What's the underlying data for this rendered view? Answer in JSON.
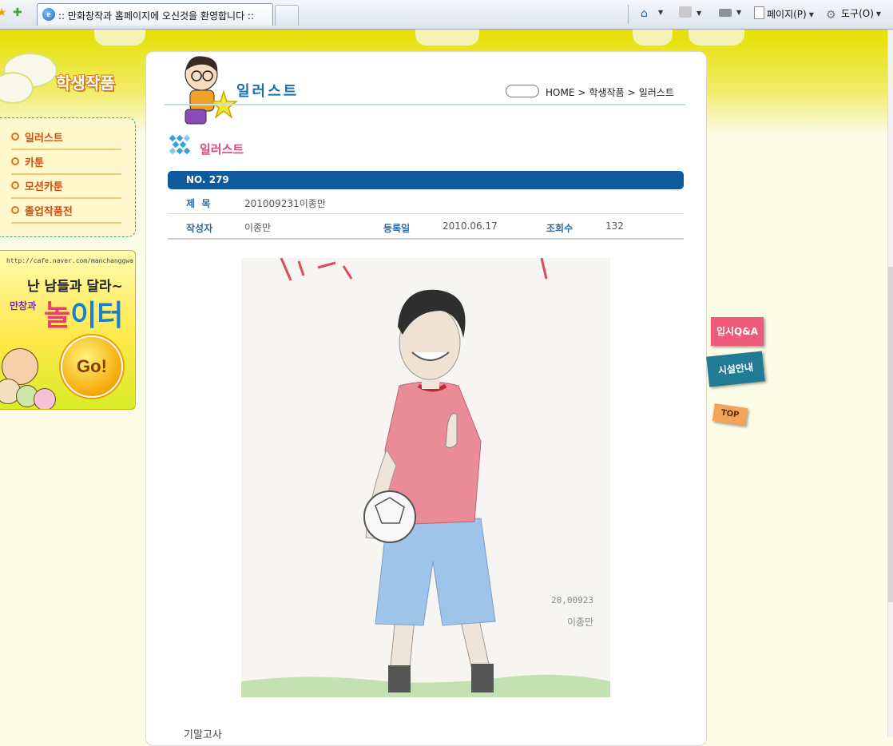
{
  "browser": {
    "tab_title": ":: 만화창작과 홈페이지에 오신것을 환영합니다 ::",
    "commands": {
      "page": "페이지(P)",
      "tools": "도구(O)"
    }
  },
  "sidebar": {
    "logo_text": "학생작품",
    "menu": [
      {
        "label": "일러스트"
      },
      {
        "label": "카툰"
      },
      {
        "label": "모션카툰"
      },
      {
        "label": "졸업작품전"
      }
    ],
    "banner": {
      "url": "http://cafe.naver.com/manchanggwa",
      "line1": "난 남들과 달라~",
      "sub": "만창과",
      "big_a": "놀",
      "big_b": "이터",
      "go": "Go!"
    }
  },
  "header": {
    "title": "일러스트",
    "breadcrumb": [
      "HOME",
      "학생작품",
      "일러스트"
    ],
    "breadcrumb_sep": ">"
  },
  "section": {
    "title": "일러스트"
  },
  "post": {
    "number_label": "NO. 279",
    "title_label": "제  목",
    "title": "201009231이종만",
    "author_label": "작성자",
    "author": "이종만",
    "date_label": "등록일",
    "date": "2010.06.17",
    "views_label": "조회수",
    "views": "132",
    "caption": "기말고사"
  },
  "artwork": {
    "signature_date": "20,00923",
    "signature_name": "이종만"
  },
  "floating": {
    "qa": "입시Q&A",
    "facility": "시설안내",
    "top": "TOP"
  }
}
